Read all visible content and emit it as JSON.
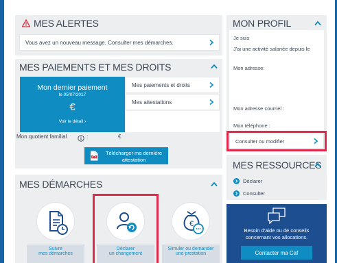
{
  "alerts": {
    "title": "MES ALERTES",
    "message": "Vous avez un nouveau message. Consulter mes démarches."
  },
  "payments": {
    "title": "MES PAIEMENTS ET MES DROITS",
    "last_payment_title": "Mon dernier paiement",
    "last_payment_date": "le 05/07/2017",
    "currency": "€",
    "detail_link": "Voir le détail",
    "link_payments": "Mes paiements et droits",
    "link_certificates": "Mes attestations",
    "quotient_label": "Mon quotient familial",
    "quotient_value": "€",
    "download_line1": "Télécharger ma dernière",
    "download_line2": "attestation"
  },
  "procedures": {
    "title": "MES DÉMARCHES",
    "items": [
      {
        "line1": "Suivre",
        "line2": "mes démarches"
      },
      {
        "line1": "Déclarer",
        "line2": "un changement"
      },
      {
        "line1": "Simuler ou demander",
        "line2": "une prestation"
      }
    ]
  },
  "profile": {
    "title": "MON PROFIL",
    "line1": "Je suis",
    "line2": "J'ai une activité salariée depuis le",
    "address_label": "Mon adresse:",
    "email_label": "Mon adresse courriel :",
    "phone_label": "Mon téléphone :",
    "edit_link": "Consulter ou modifier"
  },
  "resources": {
    "title": "MES RESSOURCES",
    "declare": "Déclarer",
    "consult": "Consulter"
  },
  "help": {
    "line1": "Besoin d'aide ou de conseils",
    "line2": "concernant vos allocations.",
    "button": "Contacter ma Caf"
  },
  "colors": {
    "accent": "#0f8cc2",
    "highlight": "#e0284a",
    "dark_blue": "#1d4e8f"
  }
}
